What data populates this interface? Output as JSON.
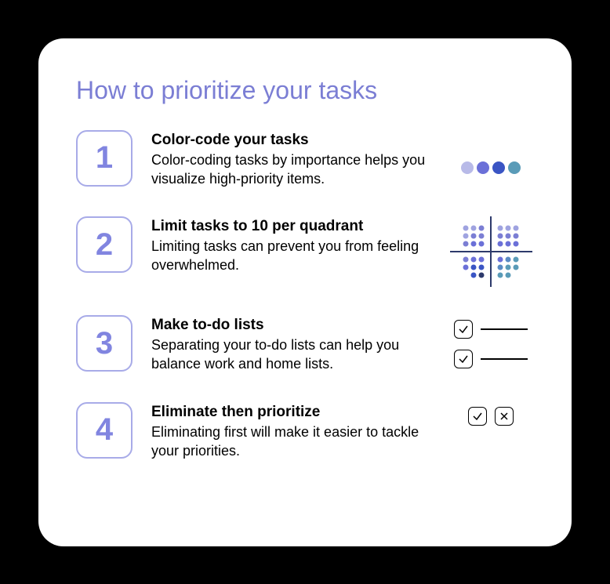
{
  "title": "How to prioritize your tasks",
  "items": [
    {
      "number": "1",
      "title": "Color-code your tasks",
      "description": "Color-coding tasks by importance helps you visualize high-priority items."
    },
    {
      "number": "2",
      "title": "Limit tasks to 10 per quadrant",
      "description": "Limiting tasks can prevent you from feeling overwhelmed."
    },
    {
      "number": "3",
      "title": "Make to-do lists",
      "description": "Separating your to-do lists can help you balance work and home lists."
    },
    {
      "number": "4",
      "title": "Eliminate then prioritize",
      "description": "Eliminating first will make it easier to tackle your priorities."
    }
  ],
  "colors": {
    "dot1": "#b8bae8",
    "dot2": "#6b70d8",
    "dot3": "#3a55c4",
    "dot4": "#5a9bb8"
  }
}
